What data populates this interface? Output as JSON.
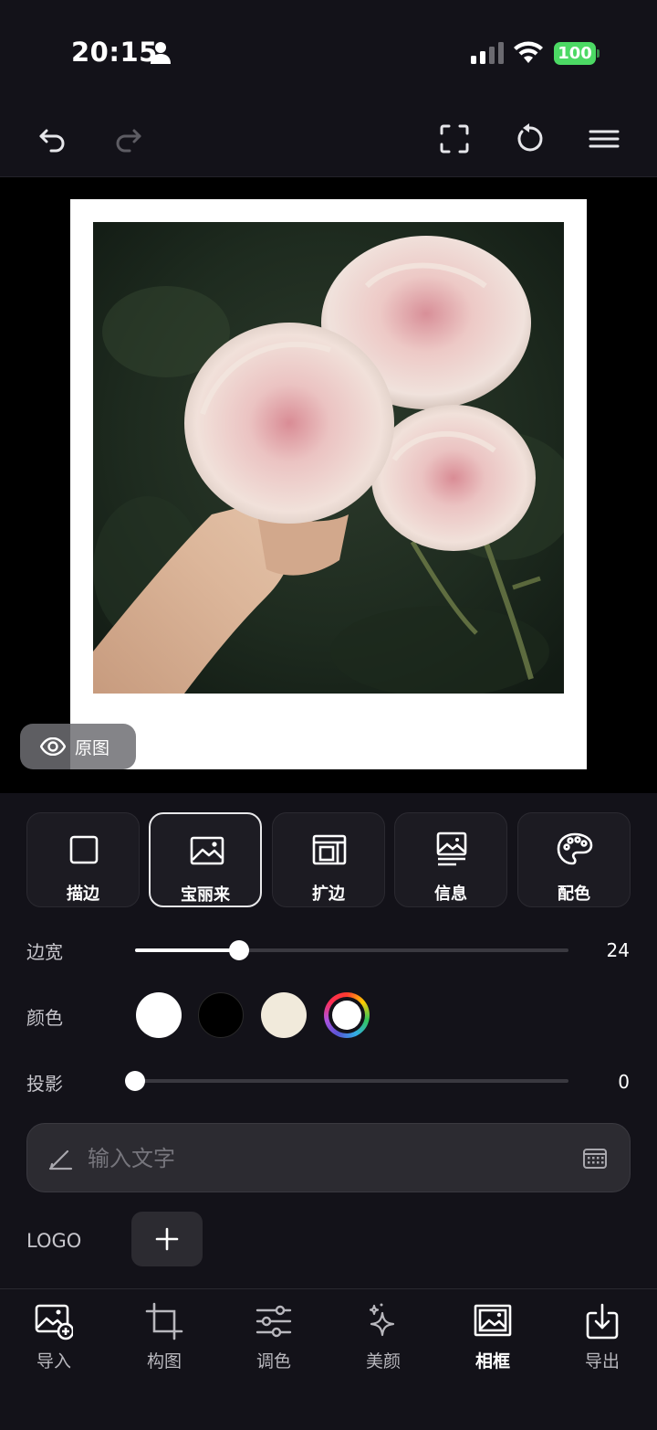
{
  "status_bar": {
    "time": "20:15",
    "battery": "100",
    "icons": [
      "person-icon",
      "signal-icon",
      "wifi-icon",
      "battery-icon"
    ]
  },
  "toolbar": {
    "icons": [
      "undo-icon",
      "redo-icon",
      "fullscreen-icon",
      "reset-icon",
      "menu-icon"
    ]
  },
  "canvas": {
    "original_label": "原图"
  },
  "frame_tabs": [
    {
      "label": "描边",
      "icon": "square-outline-icon",
      "active": false
    },
    {
      "label": "宝丽来",
      "icon": "photo-icon",
      "active": true
    },
    {
      "label": "扩边",
      "icon": "expand-frame-icon",
      "active": false
    },
    {
      "label": "信息",
      "icon": "photo-info-icon",
      "active": false
    },
    {
      "label": "配色",
      "icon": "palette-icon",
      "active": false
    }
  ],
  "border_width": {
    "label": "边宽",
    "value": "24",
    "level": 0.24
  },
  "color": {
    "label": "颜色",
    "swatches": [
      "#ffffff",
      "#000000",
      "#f1eadb",
      "custom"
    ],
    "selected": "custom"
  },
  "shadow": {
    "label": "投影",
    "value": "0",
    "level": 0
  },
  "text_input": {
    "placeholder": "输入文字",
    "value": ""
  },
  "logo": {
    "label": "LOGO"
  },
  "bottom_nav": [
    {
      "label": "导入",
      "icon": "import-photo-icon",
      "active": false
    },
    {
      "label": "构图",
      "icon": "crop-icon",
      "active": false
    },
    {
      "label": "调色",
      "icon": "adjust-sliders-icon",
      "active": false
    },
    {
      "label": "美颜",
      "icon": "sparkle-icon",
      "active": false
    },
    {
      "label": "相框",
      "icon": "frame-icon",
      "active": true
    },
    {
      "label": "导出",
      "icon": "export-icon",
      "active": false
    }
  ]
}
